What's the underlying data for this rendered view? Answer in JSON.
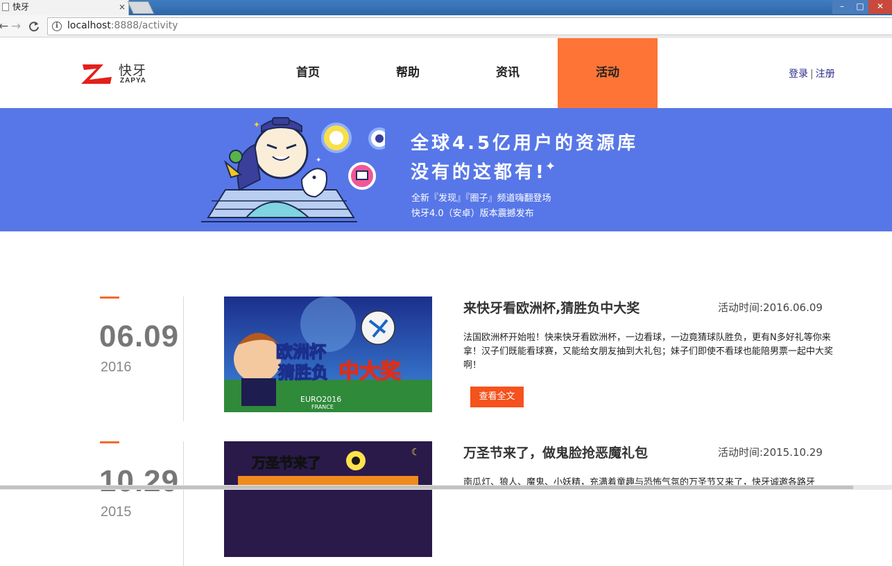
{
  "browser": {
    "tab_title": "快牙",
    "tab_close": "×",
    "url_host": "localhost",
    "url_path": ":8888/activity",
    "back_glyph": "←",
    "forward_glyph": "→",
    "reload_glyph": "C",
    "info_glyph": "i",
    "win_min": "–",
    "win_max": "□",
    "win_close": "✕"
  },
  "header": {
    "logo_cn": "快牙",
    "logo_en": "ZAPYA",
    "nav": [
      {
        "label": "首页",
        "active": false
      },
      {
        "label": "帮助",
        "active": false
      },
      {
        "label": "资讯",
        "active": false
      },
      {
        "label": "活动",
        "active": true
      }
    ],
    "login": "登录",
    "separator": "|",
    "register": "注册"
  },
  "banner": {
    "headline_1": "全球4.5亿用户的资源库",
    "headline_2": "没有的这都有!",
    "sparkle": "✦",
    "subline_1": "全新『发现』『圈子』频道嗨翻登场",
    "subline_2": "快牙4.0（安卓）版本震撼发布"
  },
  "activities": [
    {
      "day": "06.09",
      "year": "2016",
      "title": "来快牙看欧洲杯,猜胜负中大奖",
      "time": "活动时间:2016.06.09",
      "description": "法国欧洲杯开始啦！快来快牙看欧洲杯，一边看球，一边竟猜球队胜负，更有N多好礼等你来拿！汉子们既能看球赛，又能给女朋友抽到大礼包；妹子们即使不看球也能陪男票一起中大奖啊！",
      "button": "查看全文",
      "thumb_text_1": "欧洲杯",
      "thumb_text_2": "猜胜负",
      "thumb_text_3": "中大奖",
      "thumb_logo": "EURO2016",
      "thumb_sub": "FRANCE"
    },
    {
      "day": "10.29",
      "year": "2015",
      "title": "万圣节来了，做鬼脸抢恶魔礼包",
      "time": "活动时间:2015.10.29",
      "description": "南瓜灯、狼人、魔鬼、小妖精，充满着童趣与恐怖气氛的万圣节又来了，快牙诚邀各路牙",
      "thumb_text_1": "万圣节来了"
    }
  ],
  "colors": {
    "accent": "#fd7436",
    "banner_bg": "#5777e8",
    "button": "#f5521d"
  }
}
